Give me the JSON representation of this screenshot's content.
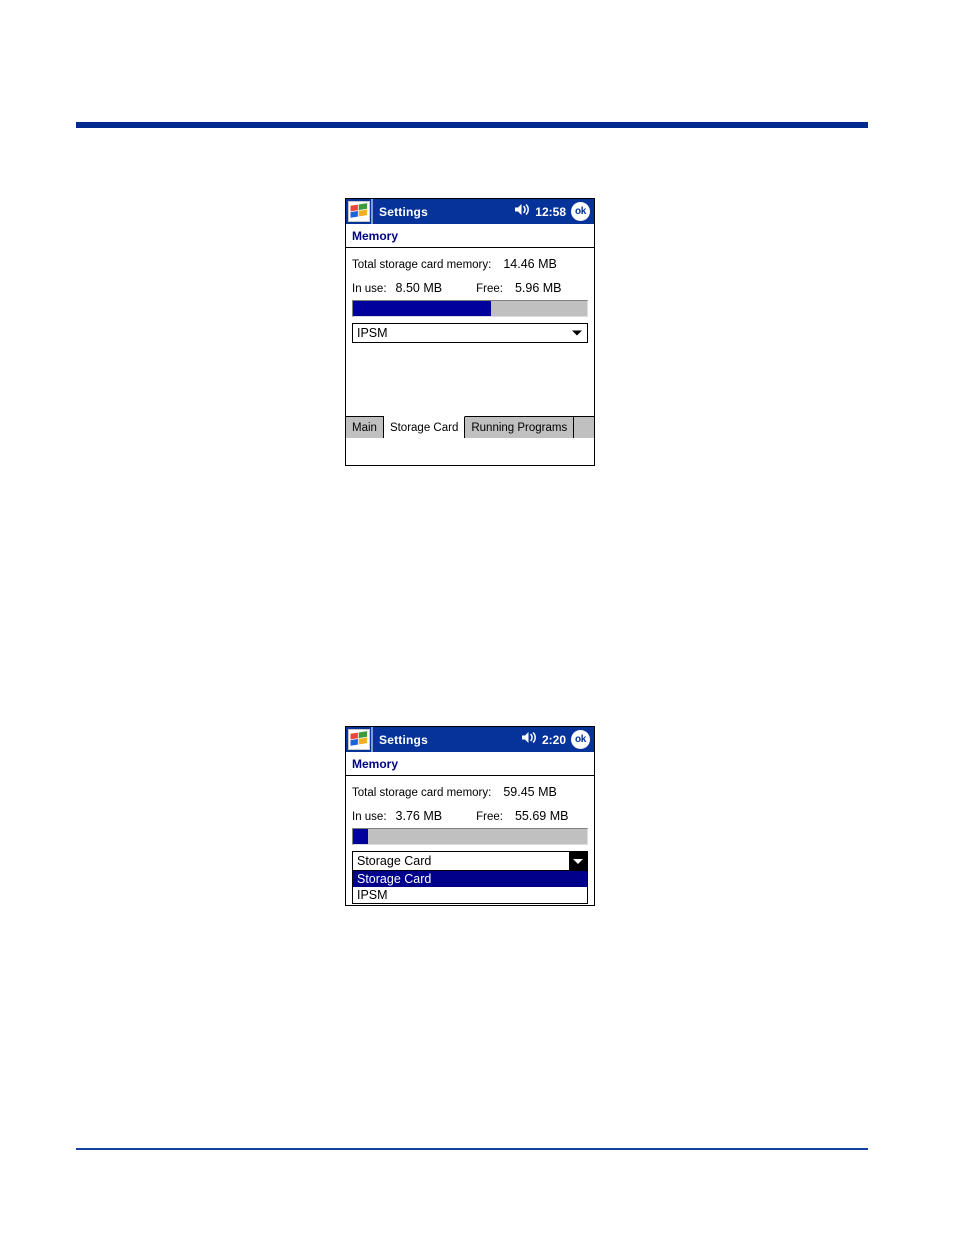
{
  "page": {
    "rule_color_top": "#012a8e",
    "rule_color_bottom": "#12429c"
  },
  "screenshots": [
    {
      "id": "memory-storage-card",
      "titlebar": {
        "start_icon": "windows-flag-icon",
        "title": "Settings",
        "volume_icon": "speaker-icon",
        "clock": "12:58",
        "ok_label": "ok"
      },
      "app_header": {
        "title": "Memory"
      },
      "fields": {
        "total_label": "Total storage card memory:",
        "total_value": "14.46 MB",
        "inuse_label": "In use:",
        "inuse_value": "8.50 MB",
        "free_label": "Free:",
        "free_value": "5.96 MB"
      },
      "progress": {
        "percent": 58.8,
        "fill_color": "#00009c",
        "track_color": "#c0c0c0"
      },
      "combo": {
        "selected": "IPSM",
        "arrow_icon": "chevron-down-icon"
      },
      "tabs": [
        {
          "label": "Main",
          "active": false
        },
        {
          "label": "Storage Card",
          "active": true
        },
        {
          "label": "Running Programs",
          "active": false
        }
      ]
    },
    {
      "id": "memory-storage-card-dropdown-open",
      "titlebar": {
        "start_icon": "windows-flag-icon",
        "title": "Settings",
        "volume_icon": "speaker-icon",
        "clock": "2:20",
        "ok_label": "ok"
      },
      "app_header": {
        "title": "Memory"
      },
      "fields": {
        "total_label": "Total storage card memory:",
        "total_value": "59.45 MB",
        "inuse_label": "In use:",
        "inuse_value": "3.76 MB",
        "free_label": "Free:",
        "free_value": "55.69 MB"
      },
      "progress": {
        "percent": 6.3,
        "fill_color": "#00009c",
        "track_color": "#c0c0c0"
      },
      "combo": {
        "selected": "Storage Card",
        "arrow_icon": "chevron-down-icon"
      },
      "dropdown_options": [
        {
          "label": "Storage Card",
          "selected": true
        },
        {
          "label": "IPSM",
          "selected": false
        }
      ]
    }
  ]
}
